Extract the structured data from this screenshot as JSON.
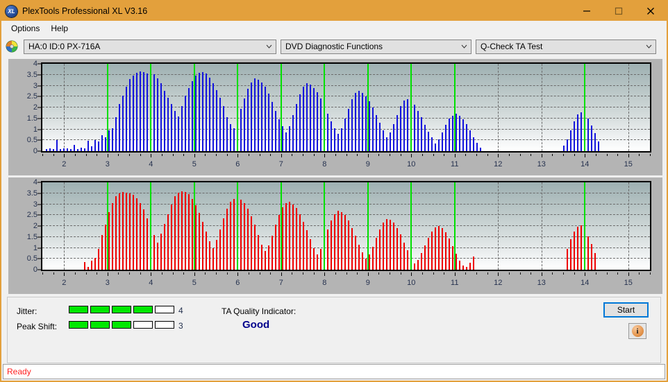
{
  "window": {
    "title": "PlexTools Professional XL V3.16",
    "icon": "xl-app-icon",
    "controls": {
      "minimize": "minimize-icon",
      "maximize": "maximize-icon",
      "close": "close-icon"
    }
  },
  "menubar": {
    "items": [
      {
        "label": "Options"
      },
      {
        "label": "Help"
      }
    ]
  },
  "toolbar": {
    "drive_icon": "optical-disc-icon",
    "drive_select": {
      "value": "HA:0 ID:0  PX-716A"
    },
    "function_select": {
      "value": "DVD Diagnostic Functions"
    },
    "test_select": {
      "value": "Q-Check TA Test"
    }
  },
  "results": {
    "jitter_label": "Jitter:",
    "jitter_value": "4",
    "jitter_segments": 5,
    "jitter_filled": 4,
    "peak_shift_label": "Peak Shift:",
    "peak_shift_value": "3",
    "peak_shift_segments": 5,
    "peak_shift_filled": 3,
    "ta_quality_label": "TA Quality Indicator:",
    "ta_quality_value": "Good",
    "start_button": "Start",
    "info_button": "i",
    "meter_on_color": "#00e800",
    "ta_value_color": "#00008c"
  },
  "statusbar": {
    "text": "Ready",
    "color": "#ff2020"
  },
  "chart_data": [
    {
      "id": "jitter-chart",
      "type": "bar",
      "title": "",
      "xlabel": "",
      "ylabel": "",
      "series_color": "#1414dc",
      "marker_color": "#00e000",
      "grid": true,
      "legend": "none",
      "xlim": [
        1.5,
        15.5
      ],
      "ylim": [
        0,
        4
      ],
      "yticks": [
        0,
        0.5,
        1,
        1.5,
        2,
        2.5,
        3,
        3.5,
        4
      ],
      "ytick_labels": [
        "0",
        "0.5",
        "1",
        "1.5",
        "2",
        "2.5",
        "3",
        "3.5",
        "4"
      ],
      "xticks": [
        2,
        3,
        4,
        5,
        6,
        7,
        8,
        9,
        10,
        11,
        12,
        13,
        14,
        15
      ],
      "xtick_labels": [
        "2",
        "3",
        "4",
        "5",
        "6",
        "7",
        "8",
        "9",
        "10",
        "11",
        "12",
        "13",
        "14",
        "15"
      ],
      "markers_x": [
        3,
        4,
        5,
        6,
        7,
        8,
        9,
        10,
        11,
        14
      ],
      "x": [
        1.6,
        1.68,
        1.76,
        1.84,
        1.92,
        2.0,
        2.08,
        2.16,
        2.24,
        2.32,
        2.4,
        2.48,
        2.56,
        2.64,
        2.72,
        2.8,
        2.88,
        2.96,
        3.04,
        3.12,
        3.2,
        3.28,
        3.36,
        3.44,
        3.52,
        3.6,
        3.68,
        3.76,
        3.84,
        3.92,
        4.0,
        4.08,
        4.16,
        4.24,
        4.32,
        4.4,
        4.48,
        4.56,
        4.64,
        4.72,
        4.8,
        4.88,
        4.96,
        5.04,
        5.12,
        5.2,
        5.28,
        5.36,
        5.44,
        5.52,
        5.6,
        5.68,
        5.76,
        5.84,
        5.92,
        6.0,
        6.08,
        6.16,
        6.24,
        6.32,
        6.4,
        6.48,
        6.56,
        6.64,
        6.72,
        6.8,
        6.88,
        6.96,
        7.04,
        7.12,
        7.2,
        7.28,
        7.36,
        7.44,
        7.52,
        7.6,
        7.68,
        7.76,
        7.84,
        7.92,
        8.0,
        8.08,
        8.16,
        8.24,
        8.32,
        8.4,
        8.48,
        8.56,
        8.64,
        8.72,
        8.8,
        8.88,
        8.96,
        9.04,
        9.12,
        9.2,
        9.28,
        9.36,
        9.44,
        9.52,
        9.6,
        9.68,
        9.76,
        9.84,
        9.92,
        10.0,
        10.08,
        10.16,
        10.24,
        10.32,
        10.4,
        10.48,
        10.56,
        10.64,
        10.72,
        10.8,
        10.88,
        10.96,
        11.04,
        11.12,
        11.2,
        11.28,
        11.36,
        11.44,
        11.52,
        11.6,
        13.52,
        13.6,
        13.68,
        13.76,
        13.84,
        13.92,
        14.0,
        14.08,
        14.16,
        14.24,
        14.32
      ],
      "values": [
        0.08,
        0.12,
        0.1,
        0.52,
        0.1,
        0.14,
        0.12,
        0.1,
        0.3,
        0.1,
        0.16,
        0.12,
        0.48,
        0.22,
        0.52,
        0.46,
        0.72,
        0.65,
        0.95,
        1.05,
        1.55,
        2.15,
        2.55,
        2.95,
        3.3,
        3.45,
        3.58,
        3.65,
        3.62,
        3.55,
        3.62,
        3.52,
        3.32,
        3.1,
        2.75,
        2.45,
        2.15,
        1.85,
        1.6,
        2.05,
        2.55,
        2.9,
        3.2,
        3.45,
        3.58,
        3.62,
        3.55,
        3.38,
        3.1,
        2.8,
        2.45,
        2.05,
        1.55,
        1.25,
        1.05,
        1.45,
        1.95,
        2.4,
        2.85,
        3.15,
        3.32,
        3.28,
        3.15,
        2.95,
        2.62,
        2.25,
        1.85,
        1.45,
        1.15,
        0.85,
        1.15,
        1.65,
        2.15,
        2.6,
        2.95,
        3.12,
        3.05,
        2.9,
        2.7,
        2.4,
        2.05,
        1.7,
        1.35,
        1.05,
        0.8,
        1.05,
        1.5,
        1.95,
        2.38,
        2.68,
        2.75,
        2.68,
        2.52,
        2.3,
        2.0,
        1.65,
        1.3,
        0.95,
        0.62,
        0.85,
        1.25,
        1.65,
        2.05,
        2.32,
        2.38,
        2.3,
        2.12,
        1.85,
        1.55,
        1.2,
        0.9,
        0.62,
        0.35,
        0.55,
        0.85,
        1.2,
        1.48,
        1.62,
        1.7,
        1.62,
        1.45,
        1.25,
        0.95,
        0.62,
        0.38,
        0.15,
        0.25,
        0.55,
        0.95,
        1.35,
        1.68,
        1.78,
        1.72,
        1.48,
        1.18,
        0.82,
        0.45
      ]
    },
    {
      "id": "peak-shift-chart",
      "type": "bar",
      "title": "",
      "xlabel": "",
      "ylabel": "",
      "series_color": "#ee0000",
      "marker_color": "#00e000",
      "grid": true,
      "legend": "none",
      "xlim": [
        1.5,
        15.5
      ],
      "ylim": [
        0,
        4
      ],
      "yticks": [
        0,
        0.5,
        1,
        1.5,
        2,
        2.5,
        3,
        3.5,
        4
      ],
      "ytick_labels": [
        "0",
        "0.5",
        "1",
        "1.5",
        "2",
        "2.5",
        "3",
        "3.5",
        "4"
      ],
      "xticks": [
        2,
        3,
        4,
        5,
        6,
        7,
        8,
        9,
        10,
        11,
        12,
        13,
        14,
        15
      ],
      "xtick_labels": [
        "2",
        "3",
        "4",
        "5",
        "6",
        "7",
        "8",
        "9",
        "10",
        "11",
        "12",
        "13",
        "14",
        "15"
      ],
      "markers_x": [
        3,
        4,
        5,
        6,
        7,
        8,
        9,
        10,
        11,
        14
      ],
      "x": [
        2.48,
        2.56,
        2.64,
        2.72,
        2.8,
        2.88,
        2.96,
        3.04,
        3.12,
        3.2,
        3.28,
        3.36,
        3.44,
        3.52,
        3.6,
        3.68,
        3.76,
        3.84,
        3.92,
        4.0,
        4.08,
        4.16,
        4.24,
        4.32,
        4.4,
        4.48,
        4.56,
        4.64,
        4.72,
        4.8,
        4.88,
        4.96,
        5.04,
        5.12,
        5.2,
        5.28,
        5.36,
        5.44,
        5.52,
        5.6,
        5.68,
        5.76,
        5.84,
        5.92,
        6.0,
        6.08,
        6.16,
        6.24,
        6.32,
        6.4,
        6.48,
        6.56,
        6.64,
        6.72,
        6.8,
        6.88,
        6.96,
        7.04,
        7.12,
        7.2,
        7.28,
        7.36,
        7.44,
        7.52,
        7.6,
        7.68,
        7.76,
        7.84,
        7.92,
        8.0,
        8.08,
        8.16,
        8.24,
        8.32,
        8.4,
        8.48,
        8.56,
        8.64,
        8.72,
        8.8,
        8.88,
        8.96,
        9.04,
        9.12,
        9.2,
        9.28,
        9.36,
        9.44,
        9.52,
        9.6,
        9.68,
        9.76,
        9.84,
        9.92,
        10.0,
        10.08,
        10.16,
        10.24,
        10.32,
        10.4,
        10.48,
        10.56,
        10.64,
        10.72,
        10.8,
        10.88,
        10.96,
        11.04,
        11.12,
        11.2,
        11.28,
        11.36,
        11.44,
        13.6,
        13.68,
        13.76,
        13.84,
        13.92,
        14.0,
        14.08,
        14.16,
        14.24,
        14.32
      ],
      "values": [
        0.35,
        0.12,
        0.4,
        0.55,
        0.95,
        1.6,
        2.05,
        2.62,
        3.05,
        3.35,
        3.5,
        3.55,
        3.52,
        3.48,
        3.42,
        3.28,
        3.05,
        2.75,
        2.35,
        1.95,
        1.6,
        1.25,
        1.65,
        2.1,
        2.55,
        3.0,
        3.35,
        3.52,
        3.58,
        3.55,
        3.45,
        3.25,
        2.95,
        2.6,
        2.2,
        1.75,
        1.3,
        1.0,
        1.35,
        1.85,
        2.35,
        2.8,
        3.1,
        3.25,
        3.28,
        3.2,
        3.05,
        2.8,
        2.45,
        2.05,
        1.6,
        1.15,
        0.85,
        1.1,
        1.55,
        2.05,
        2.5,
        2.85,
        3.05,
        3.1,
        3.0,
        2.82,
        2.55,
        2.2,
        1.8,
        1.4,
        1.0,
        0.7,
        0.95,
        1.4,
        1.85,
        2.25,
        2.55,
        2.7,
        2.65,
        2.5,
        2.25,
        1.92,
        1.55,
        1.15,
        0.78,
        0.5,
        0.7,
        1.05,
        1.45,
        1.85,
        2.15,
        2.32,
        2.3,
        2.15,
        1.92,
        1.62,
        1.25,
        0.88,
        0.55,
        0.3,
        0.45,
        0.75,
        1.1,
        1.45,
        1.75,
        1.95,
        2.0,
        1.9,
        1.7,
        1.42,
        1.08,
        0.72,
        0.4,
        0.18,
        0.12,
        0.32,
        0.6,
        0.95,
        1.4,
        1.75,
        1.98,
        2.02,
        1.85,
        1.52,
        1.18,
        0.75
      ]
    }
  ]
}
